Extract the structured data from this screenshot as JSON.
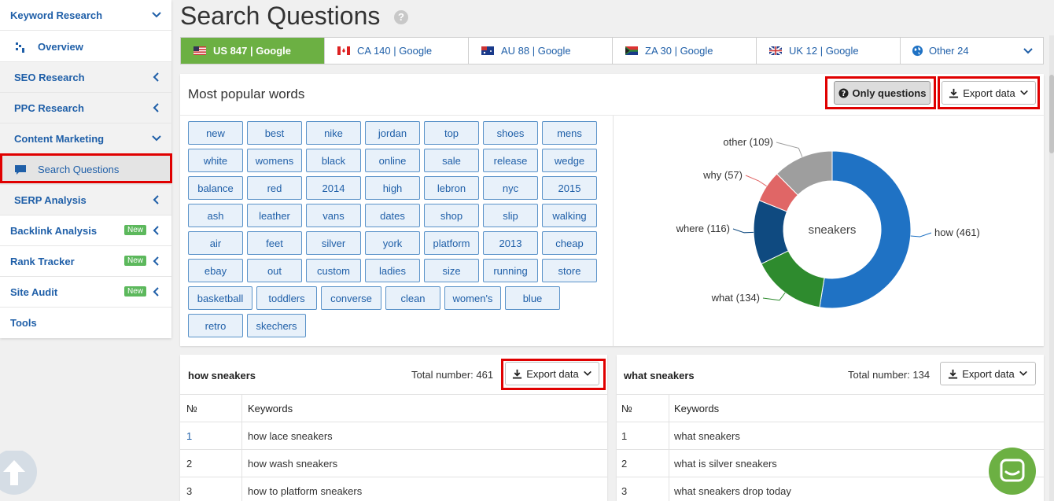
{
  "sidebar": {
    "items": [
      {
        "label": "Keyword Research"
      },
      {
        "label": "Overview"
      },
      {
        "label": "SEO Research"
      },
      {
        "label": "PPC Research"
      },
      {
        "label": "Content Marketing"
      },
      {
        "label": "Search Questions"
      },
      {
        "label": "SERP Analysis"
      },
      {
        "label": "Backlink Analysis",
        "badge": "New"
      },
      {
        "label": "Rank Tracker",
        "badge": "New"
      },
      {
        "label": "Site Audit",
        "badge": "New"
      },
      {
        "label": "Tools"
      }
    ]
  },
  "page": {
    "title": "Search Questions",
    "help": "?"
  },
  "tabs": [
    {
      "label": "US 847 | Google",
      "flag": "us-flag"
    },
    {
      "label": "CA 140 | Google",
      "flag": "ca-flag"
    },
    {
      "label": "AU 88 | Google",
      "flag": "au-flag"
    },
    {
      "label": "ZA 30 | Google",
      "flag": "za-flag"
    },
    {
      "label": "UK 12 | Google",
      "flag": "uk-flag"
    },
    {
      "label": "Other 24",
      "flag": "globe-icon"
    }
  ],
  "words_panel": {
    "title": "Most popular words",
    "only_questions": "Only questions",
    "export": "Export data",
    "words": [
      [
        "new",
        "best",
        "nike",
        "jordan",
        "top",
        "shoes",
        "mens"
      ],
      [
        "white",
        "womens",
        "black",
        "online",
        "sale",
        "release",
        "wedge"
      ],
      [
        "balance",
        "red",
        "2014",
        "high",
        "lebron",
        "nyc",
        "2015"
      ],
      [
        "ash",
        "leather",
        "vans",
        "dates",
        "shop",
        "slip",
        "walking"
      ],
      [
        "air",
        "feet",
        "silver",
        "york",
        "platform",
        "2013",
        "cheap"
      ],
      [
        "ebay",
        "out",
        "custom",
        "ladies",
        "size",
        "running",
        "store"
      ],
      [
        "basketball",
        "toddlers",
        "converse",
        "clean",
        "women's",
        "blue"
      ],
      [
        "retro",
        "skechers"
      ]
    ]
  },
  "chart_data": {
    "type": "pie",
    "title": "sneakers",
    "categories": [
      "how",
      "what",
      "where",
      "why",
      "other"
    ],
    "values": [
      461,
      134,
      116,
      57,
      109
    ],
    "labels": [
      "how (461)",
      "what (134)",
      "where (116)",
      "why (57)",
      "other (109)"
    ],
    "colors": [
      "#1f72c4",
      "#2e8b2e",
      "#0f4a80",
      "#e06666",
      "#9e9e9e"
    ]
  },
  "tables": [
    {
      "title": "how sneakers",
      "total": "Total number: 461",
      "export": "Export data",
      "headers": [
        "№",
        "Keywords"
      ],
      "rows": [
        [
          "1",
          "how lace sneakers"
        ],
        [
          "2",
          "how wash sneakers"
        ],
        [
          "3",
          "how to platform sneakers"
        ]
      ]
    },
    {
      "title": "what sneakers",
      "total": "Total number: 134",
      "export": "Export data",
      "headers": [
        "№",
        "Keywords"
      ],
      "rows": [
        [
          "1",
          "what sneakers"
        ],
        [
          "2",
          "what is silver sneakers"
        ],
        [
          "3",
          "what sneakers drop today"
        ]
      ]
    }
  ]
}
